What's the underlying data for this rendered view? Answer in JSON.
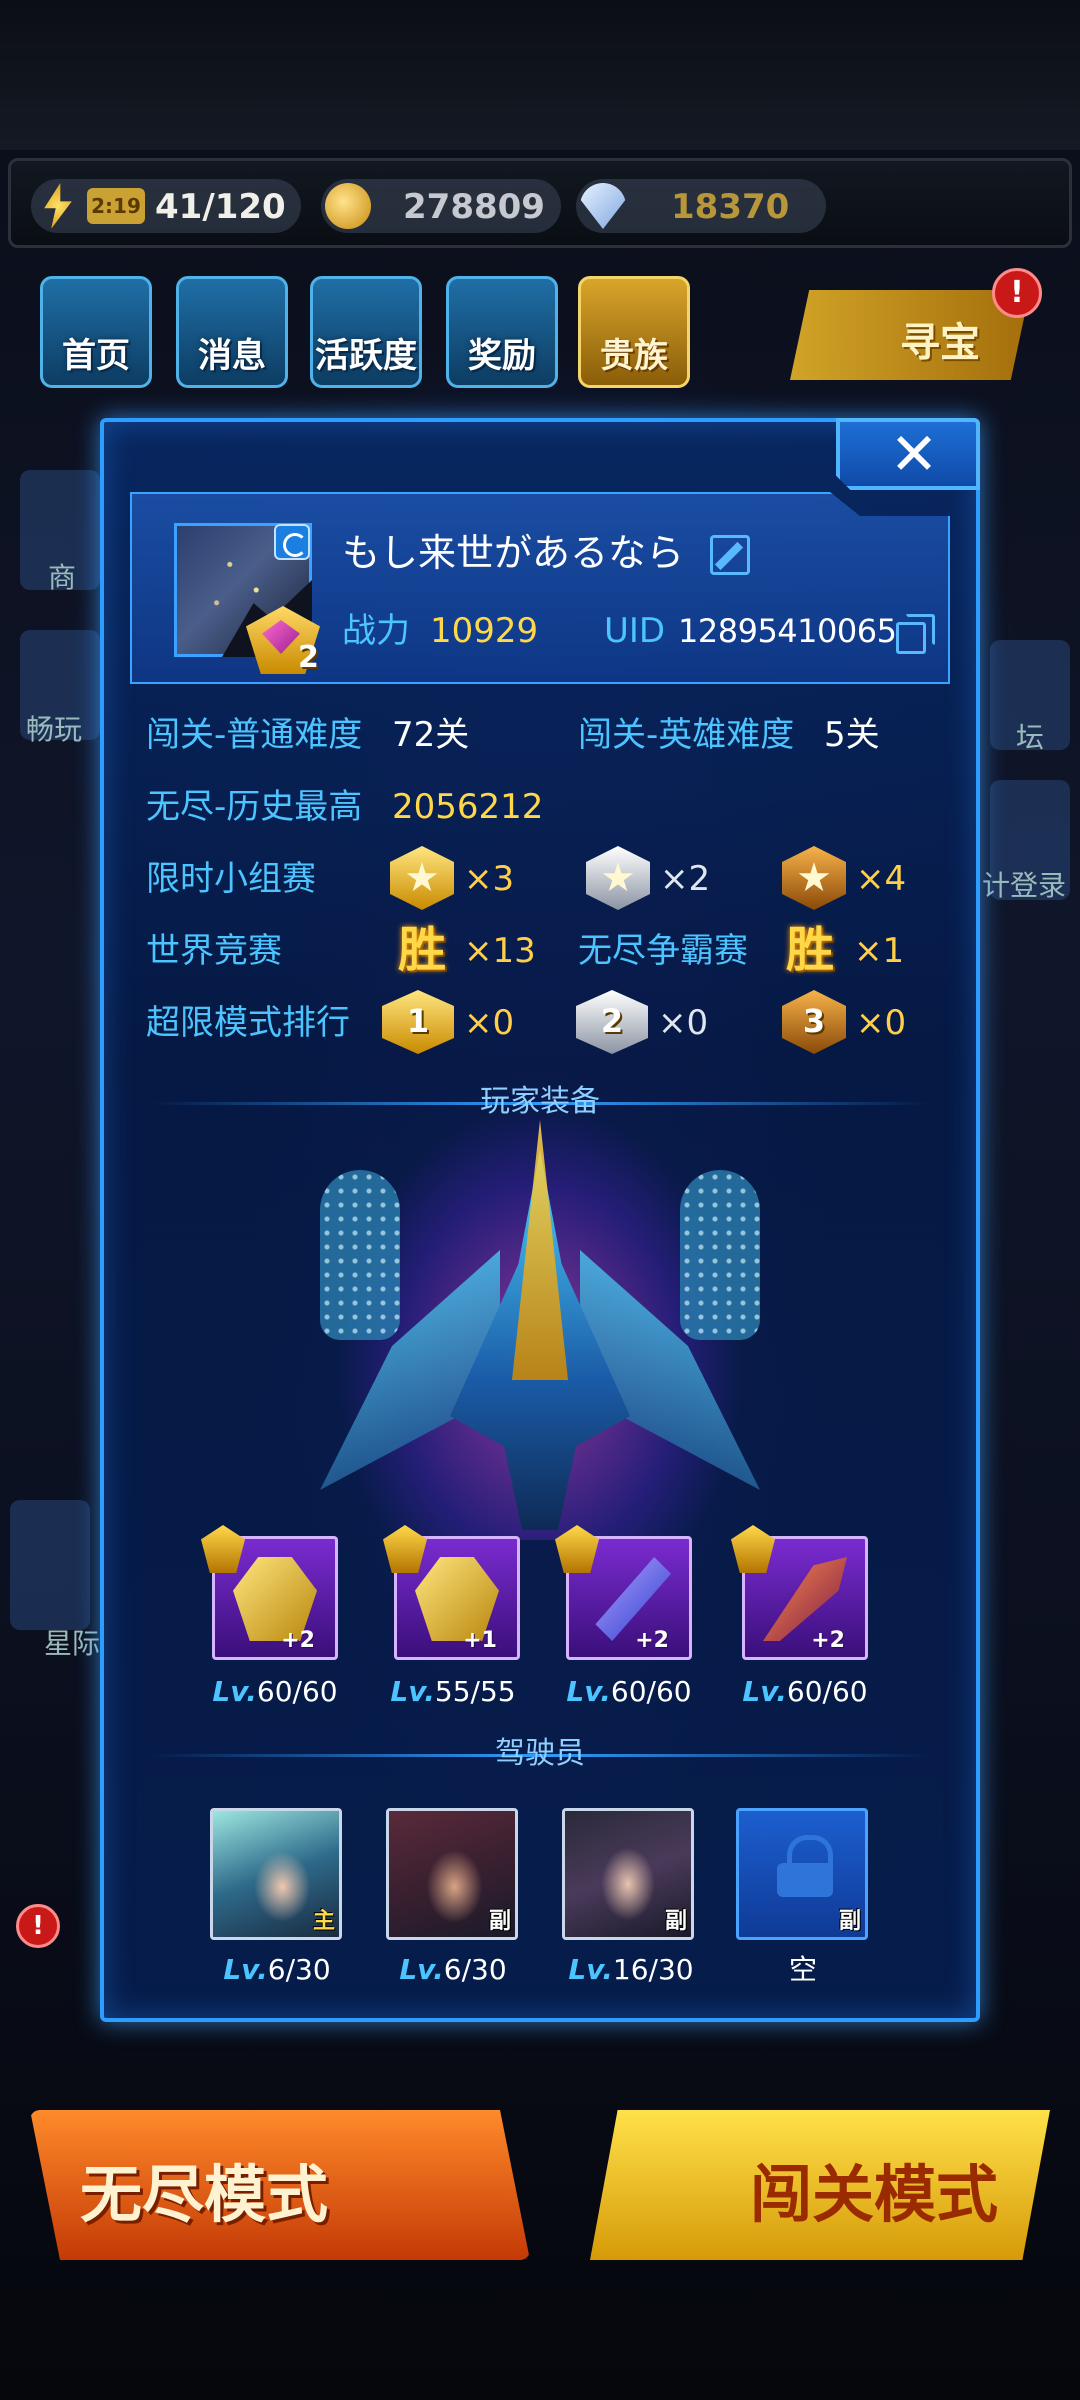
{
  "resources": {
    "energy_timer": "2:19",
    "energy": "41/120",
    "coins": "278809",
    "gems": "18370"
  },
  "nav": {
    "home": "首页",
    "messages": "消息",
    "activity": "活跃度",
    "rewards": "奖励",
    "noble": "贵族",
    "treasure": "寻宝",
    "treasure_alert": "!"
  },
  "background_side": {
    "shop": "商",
    "smooth": "畅玩",
    "forum": "坛",
    "login": "计登录",
    "star": "星际",
    "alert": "!"
  },
  "bottom": {
    "endless_mode": "无尽模式",
    "campaign_mode": "闯关模式"
  },
  "profile": {
    "name": "もし来世があるなら",
    "rank_level": "2",
    "power_label": "战力",
    "power_value": "10929",
    "uid_label": "UID",
    "uid_value": "12895410065"
  },
  "stats": {
    "normal_label": "闯关-普通难度",
    "normal_value": "72关",
    "hero_label": "闯关-英雄难度",
    "hero_value": "5关",
    "endless_label": "无尽-历史最高",
    "endless_value": "2056212",
    "group_label": "限时小组赛",
    "group_gold": "×3",
    "group_silver": "×2",
    "group_bronze": "×4",
    "world_label": "世界竞赛",
    "win_glyph": "胜",
    "world_wins": "×13",
    "endless_battle_label": "无尽争霸赛",
    "endless_battle_wins": "×1",
    "ultra_label": "超限模式排行",
    "ultra_first_num": "1",
    "ultra_second_num": "2",
    "ultra_third_num": "3",
    "ultra_first": "×0",
    "ultra_second": "×0",
    "ultra_third": "×0"
  },
  "equipment": {
    "title": "玩家装备",
    "lv_prefix": "Lv.",
    "items": [
      {
        "plus": "+2",
        "level": "60/60"
      },
      {
        "plus": "+1",
        "level": "55/55"
      },
      {
        "plus": "+2",
        "level": "60/60"
      },
      {
        "plus": "+2",
        "level": "60/60"
      }
    ]
  },
  "pilots": {
    "title": "驾驶员",
    "lv_prefix": "Lv.",
    "items": [
      {
        "tag": "主",
        "level": "6/30"
      },
      {
        "tag": "副",
        "level": "6/30"
      },
      {
        "tag": "副",
        "level": "16/30"
      },
      {
        "tag": "副",
        "level": "空"
      }
    ]
  },
  "close_glyph": "✕"
}
